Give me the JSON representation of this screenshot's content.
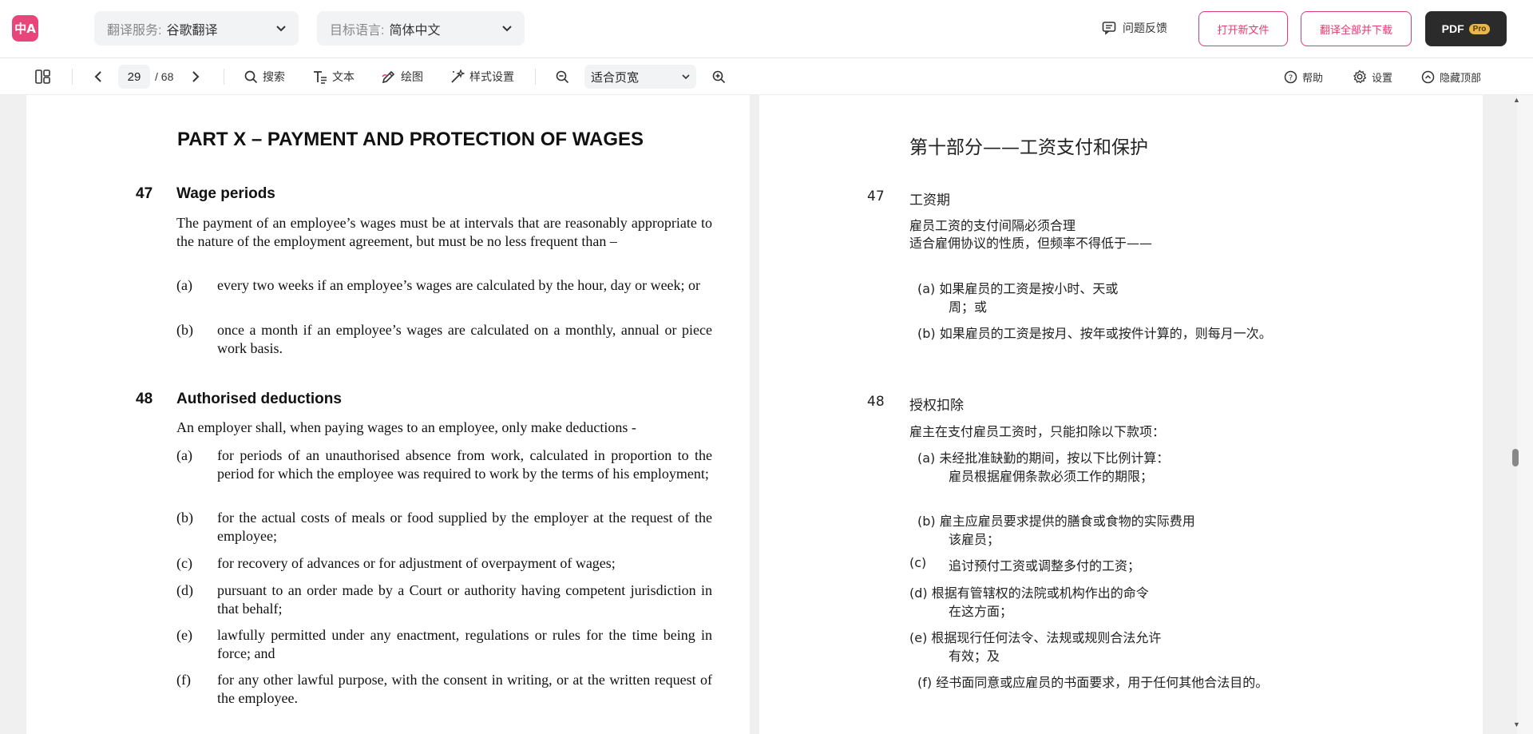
{
  "header": {
    "logo_text": "中A",
    "service_label": "翻译服务:",
    "service_value": "谷歌翻译",
    "lang_label": "目标语言:",
    "lang_value": "简体中文",
    "feedback": "问题反馈",
    "open_file": "打开新文件",
    "translate_all": "翻译全部并下载",
    "pdf": "PDF",
    "pro": "Pro"
  },
  "toolbar": {
    "page_current": "29",
    "page_total": "/ 68",
    "search": "搜索",
    "text": "文本",
    "draw": "绘图",
    "style": "样式设置",
    "zoom_value": "适合页宽",
    "help": "帮助",
    "settings": "设置",
    "hide_top": "隐藏顶部"
  },
  "original": {
    "part_title": "PART X – PAYMENT AND PROTECTION OF WAGES",
    "s47_num": "47",
    "s47_title": "Wage periods",
    "s47_intro": "The payment of an employee’s wages must be at intervals that are reasonably appropriate to the nature of the employment agreement, but must be no less frequent than –",
    "s47_items": [
      {
        "label": "(a)",
        "text": "every two weeks if an employee’s wages are calculated by the hour, day or week; or"
      },
      {
        "label": "(b)",
        "text": "once a month if an employee’s wages are calculated on a monthly, annual or piece work basis."
      }
    ],
    "s48_num": "48",
    "s48_title": "Authorised deductions",
    "s48_intro": "An employer shall, when paying wages to an employee, only make deductions -",
    "s48_items": [
      {
        "label": "(a)",
        "text": "for periods of an unauthorised absence from work, calculated in proportion to the period for which the employee was required to work by the terms of his employment;"
      },
      {
        "label": "(b)",
        "text": "for the actual costs of meals or food supplied by the employer at the request of the employee;"
      },
      {
        "label": "(c)",
        "text": "for recovery of advances or for adjustment of overpayment of wages;"
      },
      {
        "label": "(d)",
        "text": "pursuant to an order made by a Court or authority having competent jurisdiction in that behalf;"
      },
      {
        "label": "(e)",
        "text": "lawfully permitted under any enactment, regulations or rules for the time being in force; and"
      },
      {
        "label": "(f)",
        "text": "for any other lawful purpose, with the consent in writing, or at the written request of the employee."
      }
    ]
  },
  "translation": {
    "part_title": "第十部分——工资支付和保护",
    "s47_num": "47",
    "s47_title": "工资期",
    "s47_intro_1": "雇员工资的支付间隔必须合理",
    "s47_intro_2": "适合雇佣协议的性质，但频率不得低于——",
    "s47_a_1": "(a)  如果雇员的工资是按小时、天或",
    "s47_a_2": "周；或",
    "s47_b_1": "(b)  如果雇员的工资是按月、按年或按件计算的，则每月一次。",
    "s48_num": "48",
    "s48_title": "授权扣除",
    "s48_intro": "雇主在支付雇员工资时，只能扣除以下款项：",
    "s48_a_1": "(a)  未经批准缺勤的期间，按以下比例计算：",
    "s48_a_2": "雇员根据雇佣条款必须工作的期限；",
    "s48_b_1": "(b)  雇主应雇员要求提供的膳食或食物的实际费用",
    "s48_b_2": "该雇员；",
    "s48_c_label": "(c)",
    "s48_c_text": "追讨预付工资或调整多付的工资；",
    "s48_d_1": "(d) 根据有管辖权的法院或机构作出的命令",
    "s48_d_2": "在这方面；",
    "s48_e_1": "(e) 根据现行任何法令、法规或规则合法允许",
    "s48_e_2": "有效；及",
    "s48_f": "(f)  经书面同意或应雇员的书面要求，用于任何其他合法目的。"
  },
  "colors": {
    "accent": "#e23b6e",
    "pdf_button": "#2b2b2b",
    "pro_badge": "#e9b64a"
  }
}
